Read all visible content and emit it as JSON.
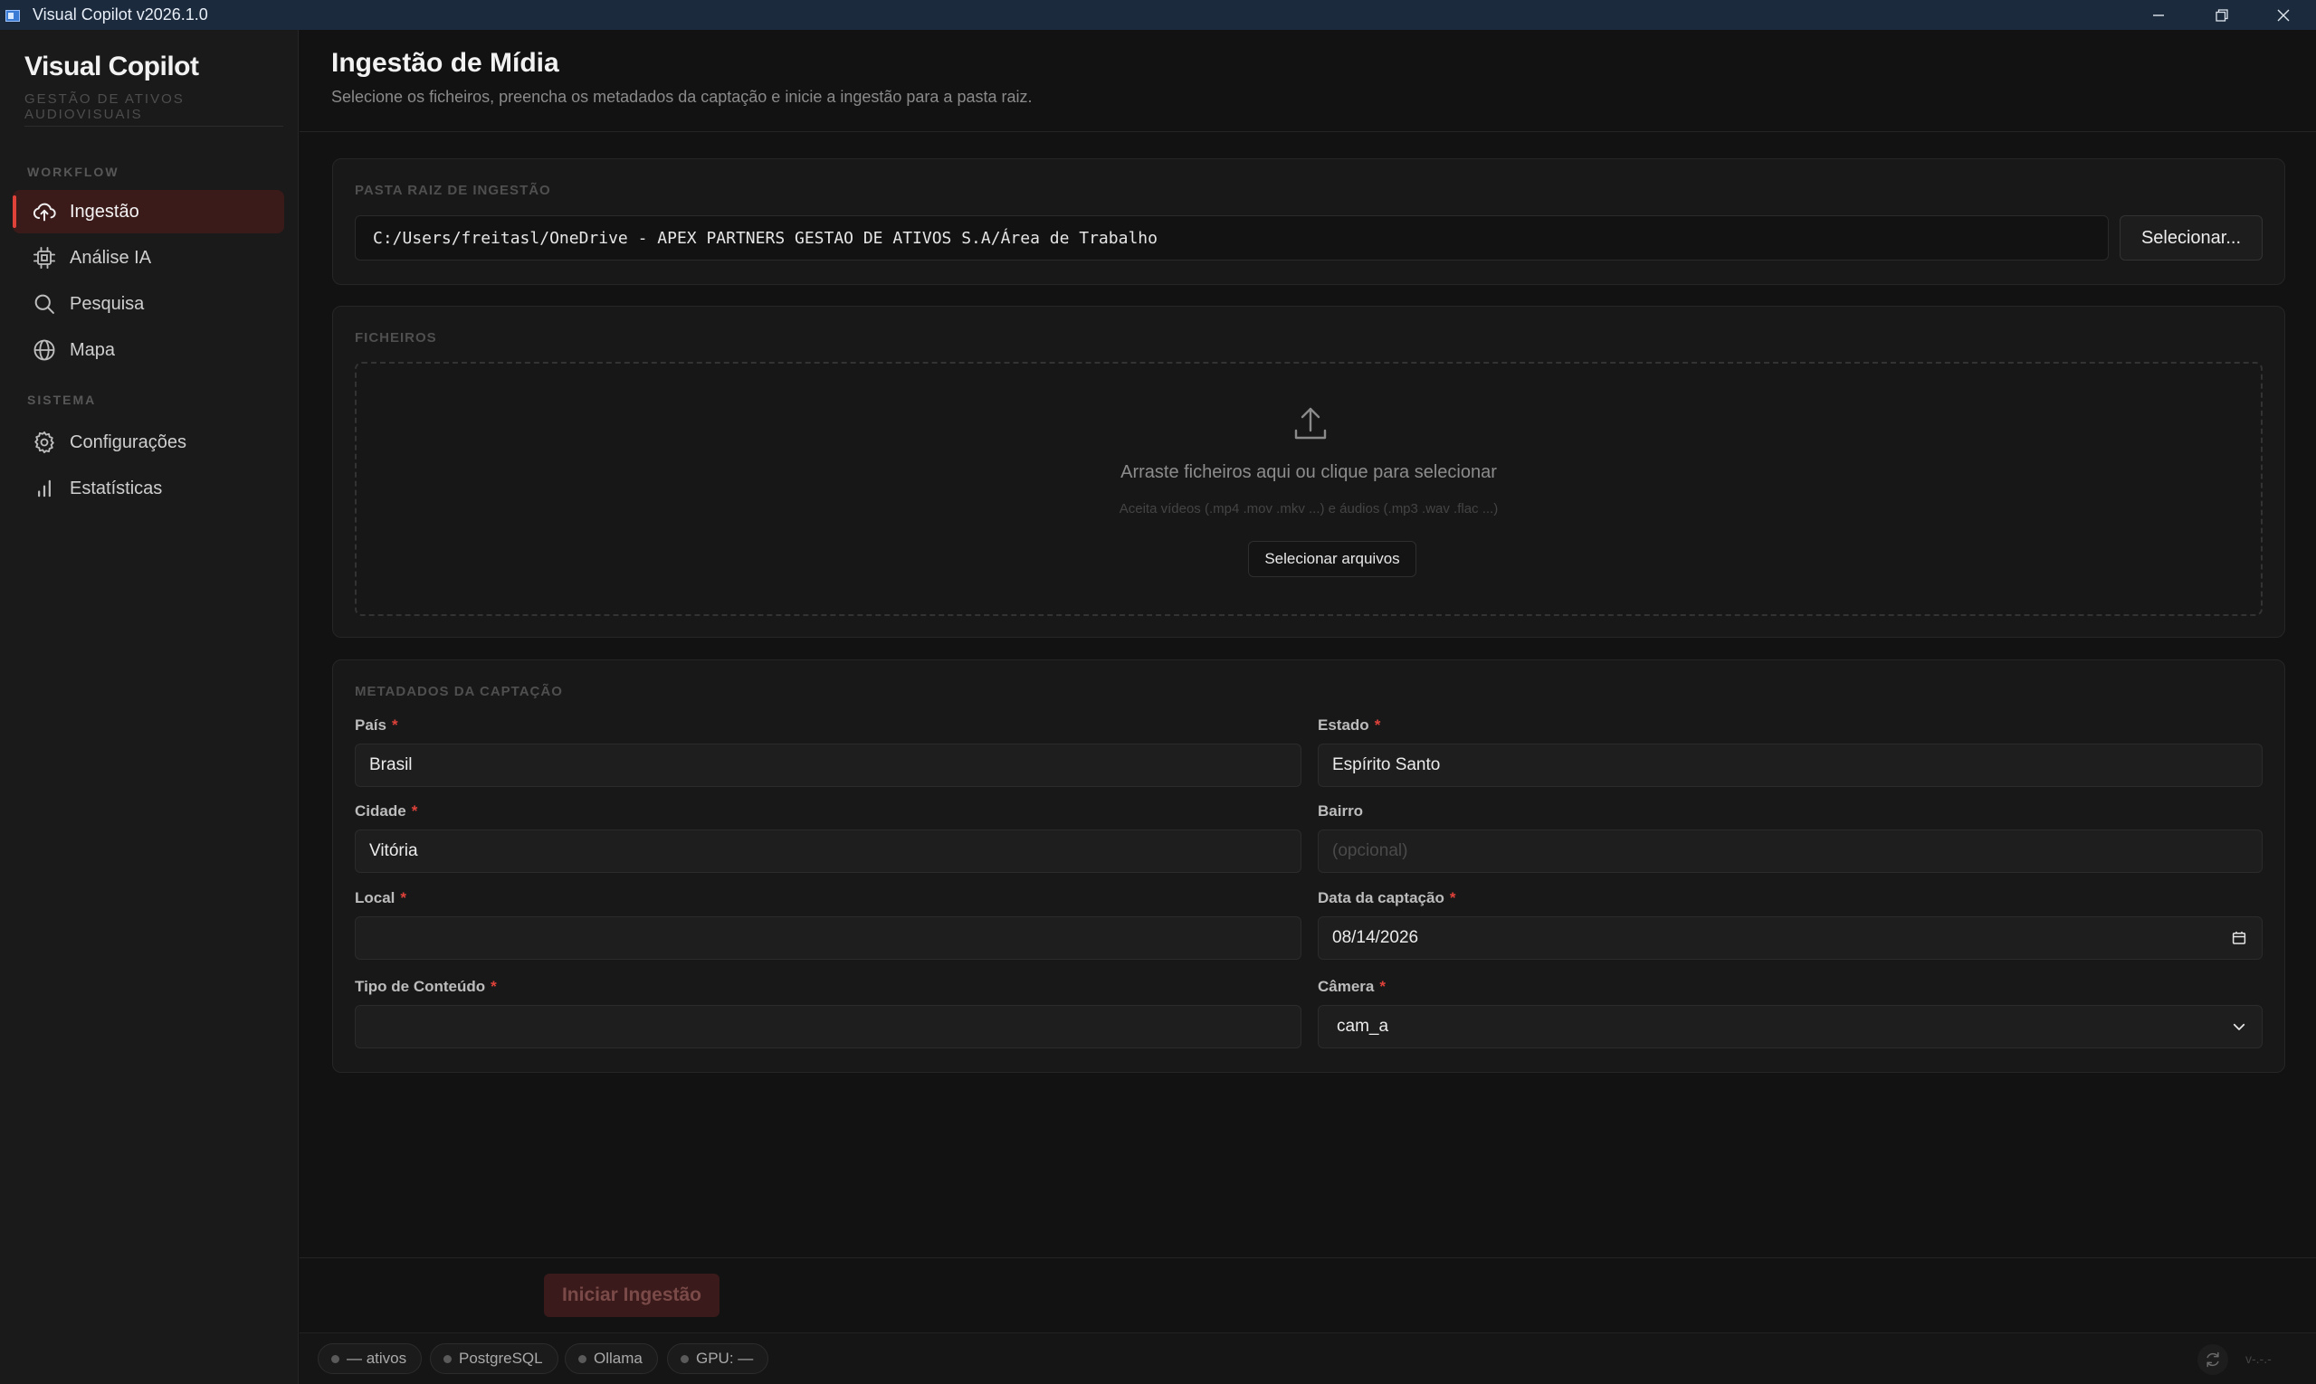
{
  "window": {
    "title": "Visual Copilot v2026.1.0"
  },
  "brand": {
    "name": "Visual Copilot",
    "subtitle": "GESTÃO DE ATIVOS AUDIOVISUAIS"
  },
  "sidebar": {
    "sections": [
      {
        "label": "WORKFLOW"
      },
      {
        "label": "SISTEMA"
      }
    ],
    "items": [
      {
        "label": "Ingestão",
        "icon": "cloud-upload-icon",
        "active": true
      },
      {
        "label": "Análise IA",
        "icon": "cpu-chip-icon",
        "active": false
      },
      {
        "label": "Pesquisa",
        "icon": "search-icon",
        "active": false
      },
      {
        "label": "Mapa",
        "icon": "globe-icon",
        "active": false
      },
      {
        "label": "Configurações",
        "icon": "gear-icon",
        "active": false
      },
      {
        "label": "Estatísticas",
        "icon": "bar-chart-icon",
        "active": false
      }
    ]
  },
  "header": {
    "title": "Ingestão de Mídia",
    "subtitle": "Selecione os ficheiros, preencha os metadados da captação e inicie a ingestão para a pasta raiz."
  },
  "root_folder": {
    "label": "PASTA RAIZ DE INGESTÃO",
    "path": "C:/Users/freitasl/OneDrive - APEX PARTNERS GESTAO DE ATIVOS S.A/Área de Trabalho",
    "button": "Selecionar..."
  },
  "files": {
    "label": "FICHEIROS",
    "drop_title": "Arraste ficheiros aqui ou clique para selecionar",
    "drop_hint": "Aceita vídeos (.mp4 .mov .mkv ...) e áudios (.mp3 .wav .flac ...)",
    "button": "Selecionar arquivos"
  },
  "metadata": {
    "label": "METADADOS DA CAPTAÇÃO",
    "required_mark": "*",
    "pais": {
      "label": "País",
      "value": "Brasil"
    },
    "estado": {
      "label": "Estado",
      "value": "Espírito Santo"
    },
    "cidade": {
      "label": "Cidade",
      "value": "Vitória"
    },
    "bairro": {
      "label": "Bairro",
      "placeholder": "(opcional)"
    },
    "local": {
      "label": "Local",
      "value": ""
    },
    "data": {
      "label": "Data da captação",
      "value": "08/14/2026"
    },
    "tipo": {
      "label": "Tipo de Conteúdo",
      "value": ""
    },
    "camera": {
      "label": "Câmera",
      "value": "cam_a"
    }
  },
  "actions": {
    "start": "Iniciar Ingestão"
  },
  "statusbar": {
    "chips": [
      {
        "label": "— ativos"
      },
      {
        "label": "PostgreSQL"
      },
      {
        "label": "Ollama"
      },
      {
        "label": "GPU: —"
      }
    ],
    "version": "v-.-.-"
  },
  "colors": {
    "accent": "#e0423a",
    "active_bg": "#3b1a1a",
    "titlebar": "#1b2a3d"
  }
}
